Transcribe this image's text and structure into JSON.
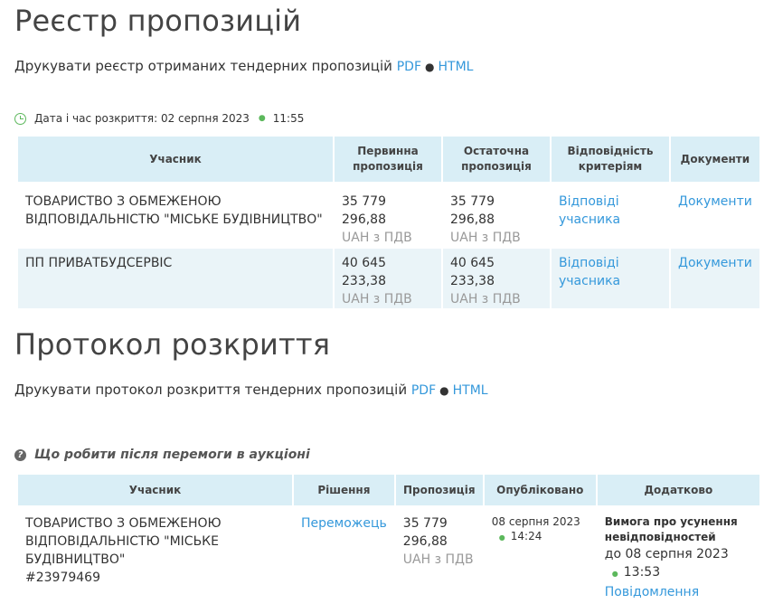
{
  "registry": {
    "title": "Реєстр пропозицій",
    "print_text": "Друкувати реєстр отриманих тендерних пропозицій",
    "pdf_label": "PDF",
    "html_label": "HTML",
    "opening_label": "Дата і час розкриття: 02 серпня 2023",
    "opening_time": "11:55",
    "headers": [
      "Учасник",
      "Первинна пропозиція",
      "Остаточна пропозиція",
      "Відповідність критеріям",
      "Документи"
    ],
    "rows": [
      {
        "participant": "ТОВАРИСТВО З ОБМЕЖЕНОЮ ВІДПОВІДАЛЬНІСТЮ \"МІСЬКЕ БУДІВНИЦТВО\"",
        "initial": "35 779 296,88",
        "initial_unit": "UAH з ПДВ",
        "final": "35 779 296,88",
        "final_unit": "UAH з ПДВ",
        "criteria": "Відповіді учасника",
        "docs": "Документи"
      },
      {
        "participant": "ПП ПРИВАТБУДСЕРВІС",
        "initial": "40 645 233,38",
        "initial_unit": "UAH з ПДВ",
        "final": "40 645 233,38",
        "final_unit": "UAH з ПДВ",
        "criteria": "Відповіді учасника",
        "docs": "Документи"
      }
    ]
  },
  "protocol": {
    "title": "Протокол розкриття",
    "print_text": "Друкувати протокол розкриття тендерних пропозицій",
    "pdf_label": "PDF",
    "html_label": "HTML",
    "help_text": "Що робити після перемоги в аукціоні",
    "headers": [
      "Учасник",
      "Рішення",
      "Пропозиція",
      "Опубліковано",
      "Додатково"
    ],
    "row": {
      "participant": "ТОВАРИСТВО З ОБМЕЖЕНОЮ ВІДПОВІДАЛЬНІСТЮ \"МІСЬКЕ БУДІВНИЦТВО\"",
      "id": "#23979469",
      "decision": "Переможець",
      "amount": "35 779 296,88",
      "amount_unit": "UAH з ПДВ",
      "published_date": "08 серпня 2023",
      "published_time": "14:24",
      "extra_title": "Вимога про усунення невідповідностей",
      "extra_deadline": "до 08 серпня 2023",
      "extra_time": "13:53",
      "extra_link": "Повідомлення"
    }
  }
}
